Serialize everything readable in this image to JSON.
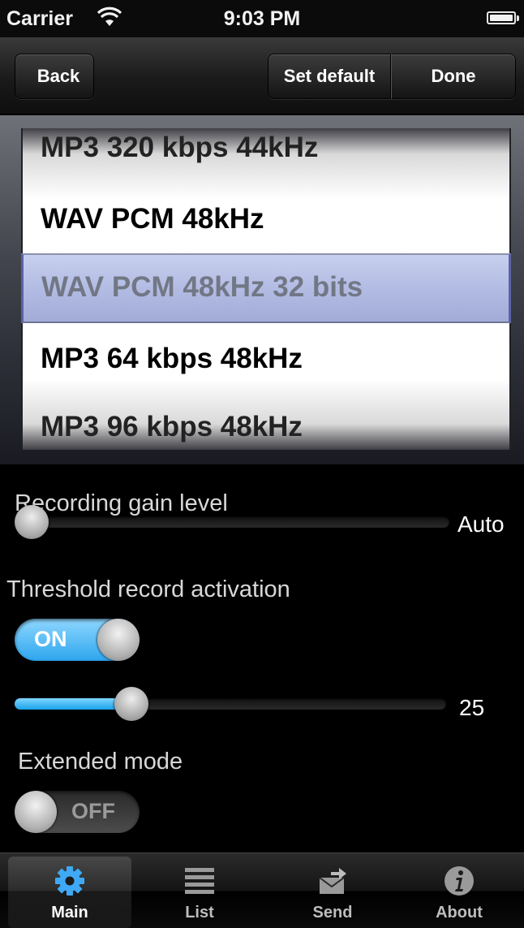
{
  "status_bar": {
    "carrier": "Carrier",
    "time": "9:03 PM"
  },
  "navbar": {
    "back_label": "Back",
    "set_default_label": "Set default",
    "done_label": "Done"
  },
  "picker": {
    "rows": [
      "MP3 320 kbps 44kHz",
      "WAV PCM 48kHz",
      "WAV PCM 48kHz 32 bits",
      "MP3 64 kbps 48kHz",
      "MP3 96 kbps 48kHz"
    ],
    "selected": "WAV PCM 48kHz 32 bits"
  },
  "recording_gain": {
    "label": "Recording gain level",
    "value_text": "Auto",
    "level": 0
  },
  "threshold": {
    "label": "Threshold record activation",
    "toggle_text": "ON",
    "value_text": "25",
    "level": 0.27
  },
  "extended_mode": {
    "label": "Extended mode",
    "toggle_text": "OFF"
  },
  "tabs": [
    {
      "label": "Main",
      "icon": "gear-icon",
      "selected": true
    },
    {
      "label": "List",
      "icon": "list-icon",
      "selected": false
    },
    {
      "label": "Send",
      "icon": "send-icon",
      "selected": false
    },
    {
      "label": "About",
      "icon": "info-icon",
      "selected": false
    }
  ],
  "colors": {
    "accent_blue": "#2ea6ee",
    "background": "#000000"
  }
}
